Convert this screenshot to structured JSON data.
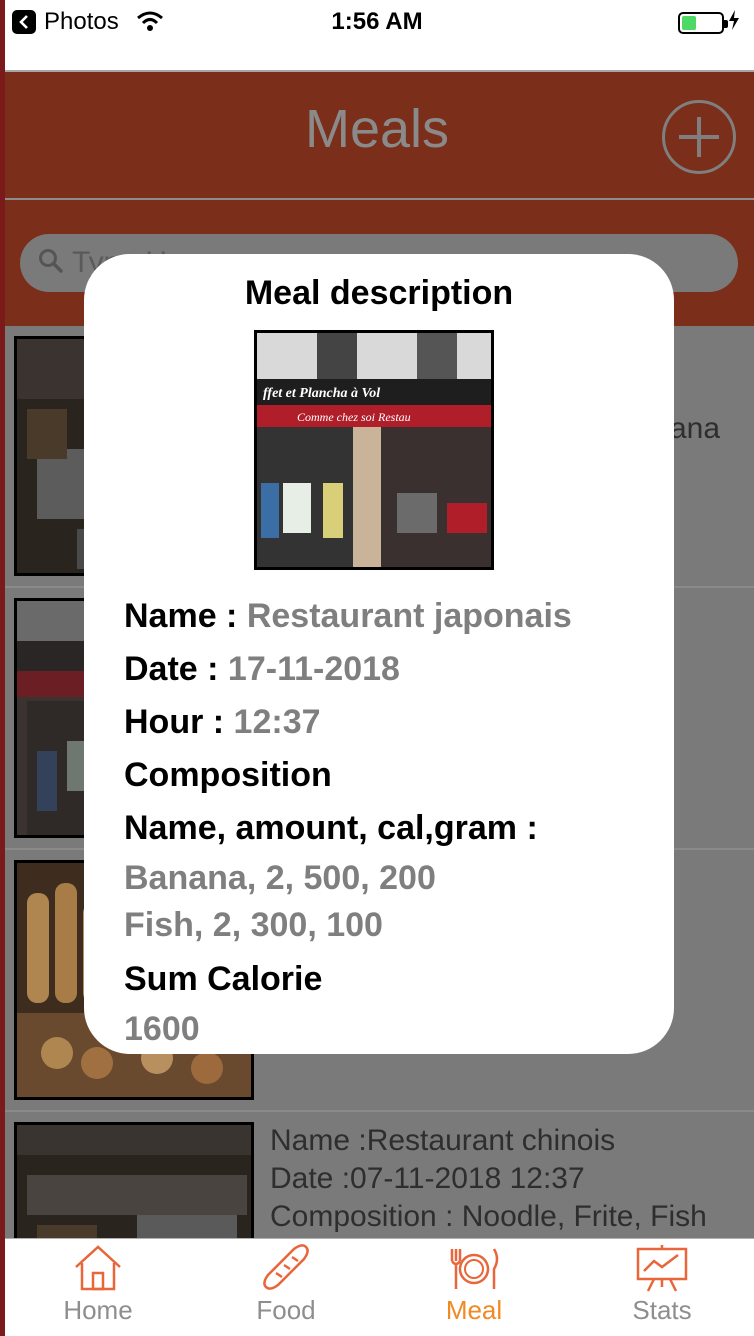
{
  "status_bar": {
    "back_app": "Photos",
    "time": "1:56 AM"
  },
  "header": {
    "title": "Meals",
    "add_icon": "plus-circle-icon"
  },
  "search": {
    "placeholder": "Type Here...",
    "icon": "search-icon"
  },
  "meals": [
    {
      "text_right": "ana"
    },
    {
      "text_right": ""
    },
    {
      "text_right": ""
    },
    {
      "name_line": "Name :Restaurant chinois",
      "date_line": "Date :07-11-2018  12:37",
      "composition_line": "Composition : Noodle, Frite, Fish"
    }
  ],
  "modal": {
    "title": "Meal description",
    "name_label": "Name : ",
    "name_value": "Restaurant japonais",
    "date_label": "Date : ",
    "date_value": "17-11-2018",
    "hour_label": "Hour : ",
    "hour_value": "12:37",
    "composition_label": "Composition",
    "composition_header": "Name, amount, cal,gram :",
    "composition_items": [
      "Banana, 2, 500, 200",
      "Fish, 2, 300, 100"
    ],
    "sum_label": "Sum Calorie",
    "sum_value": "1600"
  },
  "tabs": [
    {
      "label": "Home",
      "icon": "house-icon",
      "active": false
    },
    {
      "label": "Food",
      "icon": "baguette-icon",
      "active": false
    },
    {
      "label": "Meal",
      "icon": "plate-cutlery-icon",
      "active": true
    },
    {
      "label": "Stats",
      "icon": "chart-board-icon",
      "active": false
    }
  ],
  "colors": {
    "header_bg": "#7b2e19",
    "accent": "#f08a24",
    "tab_icon": "#e8663a",
    "muted_text": "#7f7f7f"
  }
}
